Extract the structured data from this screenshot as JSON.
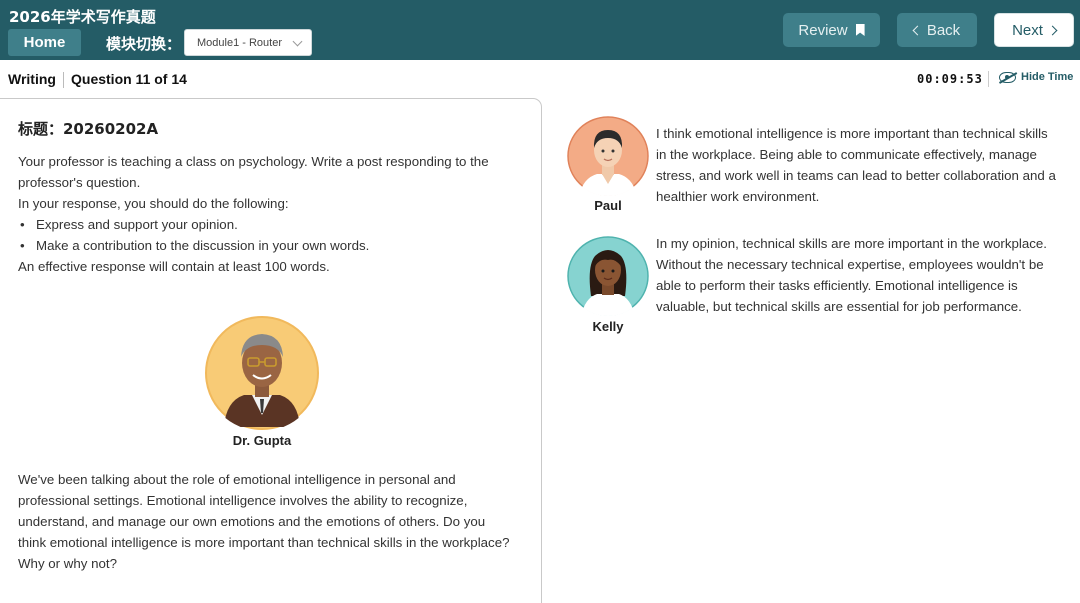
{
  "app": {
    "title": "2026年学术写作真题",
    "home_label": "Home",
    "module_label": "模块切换：",
    "module_selected": "Module1 - Router"
  },
  "nav": {
    "review_label": "Review",
    "back_label": "Back",
    "next_label": "Next"
  },
  "status": {
    "section": "Writing",
    "question": "Question 11 of 14",
    "timer": "00:09:53",
    "hide_time_label": "Hide Time"
  },
  "prompt": {
    "title": "标题：20260202A",
    "intro": "Your professor is teaching a class on psychology. Write a post responding to the professor's question.",
    "instruction": "In your response, you should do the following:",
    "bullets": [
      "Express and support your opinion.",
      "Make a contribution to the discussion in your own words."
    ],
    "length_note": "An effective response will contain at least 100 words.",
    "professor_name": "Dr. Gupta",
    "discussion": "We've been talking about the role of emotional intelligence in personal and professional settings. Emotional intelligence involves the ability to recognize, understand, and manage our own emotions and the emotions of others. Do you think emotional intelligence is more important than technical skills in the workplace? Why or why not?"
  },
  "posts": [
    {
      "name": "Paul",
      "text": "I think emotional intelligence is more important than technical skills in the workplace. Being able to communicate effectively, manage stress, and work well in teams can lead to better collaboration and a healthier work environment.",
      "avatar_bg": "#f3ab86"
    },
    {
      "name": "Kelly",
      "text": "In my opinion, technical skills are more important in the workplace. Without the necessary technical expertise, employees wouldn't be able to perform their tasks efficiently. Emotional intelligence is valuable, but technical skills are essential for job performance.",
      "avatar_bg": "#86d3d0"
    }
  ],
  "colors": {
    "header_bg": "#245c66",
    "button_bg": "#3f7f8a",
    "professor_avatar_bg": "#f8cb76"
  }
}
